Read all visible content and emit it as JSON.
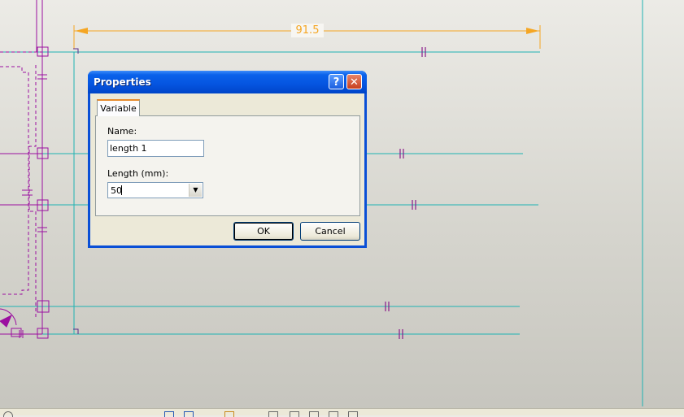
{
  "dimension": {
    "value": "91.5"
  },
  "dialog": {
    "title": "Properties",
    "help_glyph": "?",
    "close_glyph": "✕",
    "tab_label": "Variable",
    "name_label": "Name:",
    "name_value": "length 1",
    "length_label": "Length (mm):",
    "length_value": "50",
    "ok_label": "OK",
    "cancel_label": "Cancel"
  },
  "colors": {
    "construction_line": "#1fb3b3",
    "profile_line": "#9b0fa0",
    "dimension": "#f5a623",
    "titlebar": "#0a5ae0"
  }
}
